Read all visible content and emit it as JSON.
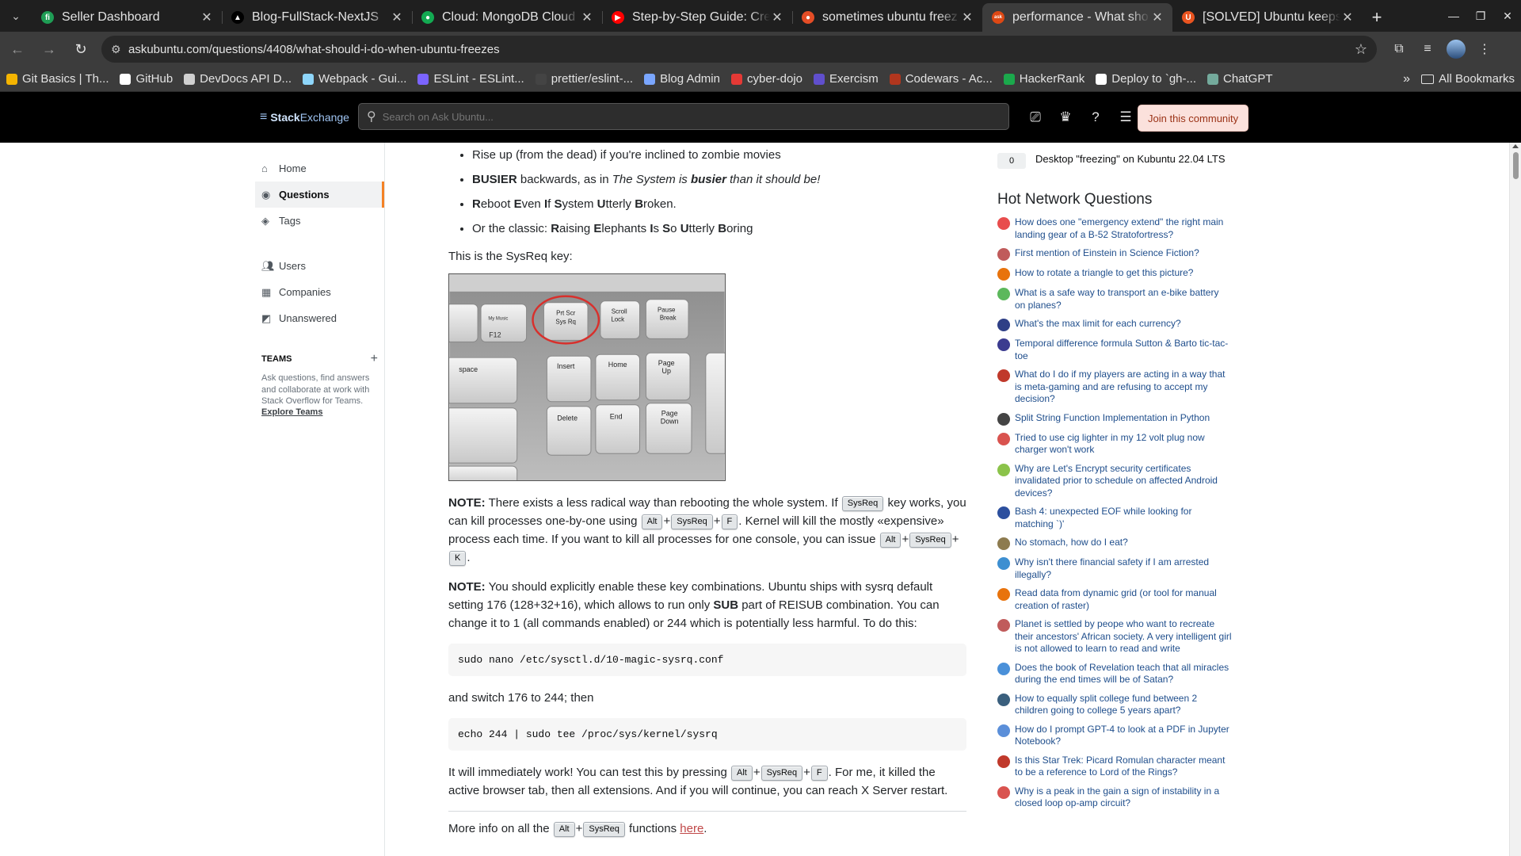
{
  "browser": {
    "tabs": [
      {
        "title": "Seller Dashboard",
        "color": "#1f9d55",
        "glyph": "fi"
      },
      {
        "title": "Blog-FullStack-NextJS",
        "color": "#000000",
        "glyph": "▲"
      },
      {
        "title": "Cloud: MongoDB Cloud",
        "color": "#13aa52",
        "glyph": "●"
      },
      {
        "title": "Step-by-Step Guide: Crea",
        "color": "#ff0000",
        "glyph": "▶"
      },
      {
        "title": "sometimes ubuntu freez",
        "color": "#e44d26",
        "glyph": "●"
      },
      {
        "title": "performance - What sho",
        "color": "#dd4814",
        "glyph": "ask"
      },
      {
        "title": "[SOLVED] Ubuntu keeps",
        "color": "#e95420",
        "glyph": "U"
      }
    ],
    "active_tab": 5,
    "url": "askubuntu.com/questions/4408/what-should-i-do-when-ubuntu-freezes",
    "bookmarks": [
      {
        "label": "Git Basics | Th...",
        "color": "#f4b400"
      },
      {
        "label": "GitHub",
        "color": "#ffffff"
      },
      {
        "label": "DevDocs API D...",
        "color": "#d0d0d0"
      },
      {
        "label": "Webpack - Gui...",
        "color": "#8ed6fb"
      },
      {
        "label": "ESLint - ESLint...",
        "color": "#7b64ff"
      },
      {
        "label": "prettier/eslint-...",
        "color": "#444444"
      },
      {
        "label": "Blog Admin",
        "color": "#7aa6ff"
      },
      {
        "label": "cyber-dojo",
        "color": "#e53935"
      },
      {
        "label": "Exercism",
        "color": "#604fcd"
      },
      {
        "label": "Codewars - Ac...",
        "color": "#b1361e"
      },
      {
        "label": "HackerRank",
        "color": "#1ba94c"
      },
      {
        "label": "Deploy to `gh-...",
        "color": "#ffffff"
      },
      {
        "label": "ChatGPT",
        "color": "#74aa9c"
      }
    ],
    "more_glyph": "»",
    "all_bookmarks": "All Bookmarks"
  },
  "header": {
    "logo_stack": "Stack",
    "logo_exchange": "Exchange",
    "search_placeholder": "Search on Ask Ubuntu...",
    "join": "Join this community"
  },
  "nav": {
    "home": "Home",
    "questions": "Questions",
    "tags": "Tags",
    "users": "Users",
    "companies": "Companies",
    "unanswered": "Unanswered",
    "teams_title": "TEAMS",
    "teams_text": "Ask questions, find answers and collaborate at work with Stack Overflow for Teams.",
    "teams_link": "Explore Teams"
  },
  "post": {
    "bullet1": "Rise up (from the dead) if you're inclined to zombie movies",
    "b2_busier": "BUSIER",
    "b2_text": " backwards, as in ",
    "b2_italic": "The System is ",
    "b2_bi": "busier",
    "b2_end": " than it should be!",
    "sysreq_intro": "This is the SysReq key:",
    "note_label": "NOTE:",
    "note1_a": " There exists a less radical way than rebooting the whole system. If ",
    "note1_b": " key works, you can kill processes one-by-one using ",
    "note1_c": ". Kernel will kill the mostly «expensive» process each time. If you want to kill all processes for one console, you can issue ",
    "note2_a": " You should explicitly enable these key combinations. Ubuntu ships with sysrq default setting 176 (128+32+16), which allows to run only ",
    "note2_sub": "SUB",
    "note2_b": " part of REISUB combination. You can change it to 1 (all commands enabled) or 244 which is potentially less harmful. To do this:",
    "code1": "sudo nano /etc/sysctl.d/10-magic-sysrq.conf",
    "switch_text": "and switch 176 to 244; then",
    "code2": "echo 244 | sudo tee /proc/sys/kernel/sysrq",
    "work_a": "It will immediately work! You can test this by pressing ",
    "work_b": ". For me, it killed the active browser tab, then all extensions. And if you will continue, you can reach X Server restart.",
    "more_a": "More info on all the ",
    "more_b": " functions ",
    "more_link": "here",
    "more_end": ".",
    "kbd_sysreq": "SysReq",
    "kbd_alt": "Alt",
    "kbd_f": "F",
    "kbd_k": "K",
    "plus": "+",
    "photo_keys": {
      "prtscr": "Prt Scr",
      "sysrq": "Sys Rq",
      "scroll": "Scroll",
      "lock": "Lock",
      "pause": "Pause",
      "break": "Break",
      "insert": "Insert",
      "home": "Home",
      "page": "Page",
      "up": "Up",
      "delete": "Delete",
      "end": "End",
      "down": "Down",
      "space": "space",
      "f12": "F12",
      "mymusic": "My Music"
    }
  },
  "sidebar": {
    "related_score": "0",
    "related_title": "Desktop \"freezing\" on Kubuntu 22.04 LTS",
    "hnq_title": "Hot Network Questions",
    "hnq": [
      {
        "text": "How does one \"emergency extend\" the right main landing gear of a B-52 Stratofortress?",
        "color": "#e84d4d"
      },
      {
        "text": "First mention of Einstein in Science Fiction?",
        "color": "#c05b5b"
      },
      {
        "text": "How to rotate a triangle to get this picture?",
        "color": "#e8730c"
      },
      {
        "text": "What is a safe way to transport an e-bike battery on planes?",
        "color": "#5cb85c"
      },
      {
        "text": "What's the max limit for each currency?",
        "color": "#2f3f86"
      },
      {
        "text": "Temporal difference formula Sutton & Barto tic-tac-toe",
        "color": "#3b3b8f"
      },
      {
        "text": "What do I do if my players are acting in a way that is meta-gaming and are refusing to accept my decision?",
        "color": "#c0392b"
      },
      {
        "text": "Split String Function Implementation in Python",
        "color": "#444444"
      },
      {
        "text": "Tried to use cig lighter in my 12 volt plug now charger won't work",
        "color": "#d9534f"
      },
      {
        "text": "Why are Let's Encrypt security certificates invalidated prior to schedule on affected Android devices?",
        "color": "#8bc34a"
      },
      {
        "text": "Bash 4: unexpected EOF while looking for matching `)'",
        "color": "#2c4f9e"
      },
      {
        "text": "No stomach, how do I eat?",
        "color": "#8d7b4f"
      },
      {
        "text": "Why isn't there financial safety if I am arrested illegally?",
        "color": "#3d8fd1"
      },
      {
        "text": "Read data from dynamic grid (or tool for manual creation of raster)",
        "color": "#e8730c"
      },
      {
        "text": "Planet is settled by peope who want to recreate their ancestors' African society. A very intelligent girl is not allowed to learn to read and write",
        "color": "#c05b5b"
      },
      {
        "text": "Does the book of Revelation teach that all miracles during the end times will be of Satan?",
        "color": "#4a90d9"
      },
      {
        "text": "How to equally split college fund between 2 children going to college 5 years apart?",
        "color": "#3a5f7d"
      },
      {
        "text": "How do I prompt GPT-4 to look at a PDF in Jupyter Notebook?",
        "color": "#5b8fd9"
      },
      {
        "text": "Is this Star Trek: Picard Romulan character meant to be a reference to Lord of the Rings?",
        "color": "#c0392b"
      },
      {
        "text": "Why is a peak in the gain a sign of instability in a closed loop op-amp circuit?",
        "color": "#d9534f"
      }
    ]
  }
}
